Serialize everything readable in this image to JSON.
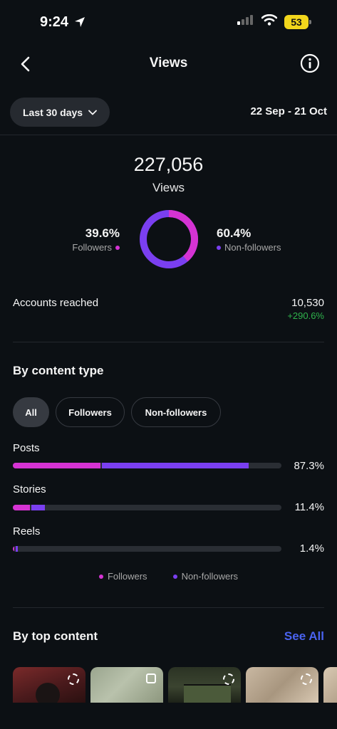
{
  "status_bar": {
    "time": "9:24",
    "battery": "53"
  },
  "header": {
    "title": "Views"
  },
  "range": {
    "selector_label": "Last 30 days",
    "dates": "22 Sep - 21 Oct"
  },
  "summary": {
    "total": "227,056",
    "total_label": "Views",
    "followers_pct": "39.6%",
    "followers_label": "Followers",
    "followers_fraction": 0.396,
    "nonfollowers_pct": "60.4%",
    "nonfollowers_label": "Non-followers",
    "nonfollowers_fraction": 0.604
  },
  "accounts_reached": {
    "label": "Accounts reached",
    "value": "10,530",
    "change": "+290.6%"
  },
  "by_content_type": {
    "title": "By content type",
    "filters": [
      "All",
      "Followers",
      "Non-followers"
    ],
    "active_filter": "All",
    "rows": [
      {
        "label": "Posts",
        "pct": "87.3%",
        "followers_fraction": 0.327,
        "nonfollowers_fraction": 0.546
      },
      {
        "label": "Stories",
        "pct": "11.4%",
        "followers_fraction": 0.063,
        "nonfollowers_fraction": 0.051
      },
      {
        "label": "Reels",
        "pct": "1.4%",
        "followers_fraction": 0.005,
        "nonfollowers_fraction": 0.009
      }
    ],
    "legend": {
      "followers": "Followers",
      "nonfollowers": "Non-followers"
    }
  },
  "by_top_content": {
    "title": "By top content",
    "see_all": "See All",
    "thumbnails": [
      "reel",
      "carousel",
      "reel",
      "reel",
      "reel"
    ]
  },
  "colors": {
    "followers": "#d533d3",
    "nonfollowers": "#7a3ff0",
    "positive": "#2fb34c",
    "link": "#4a63f0",
    "background": "#0c1014"
  }
}
